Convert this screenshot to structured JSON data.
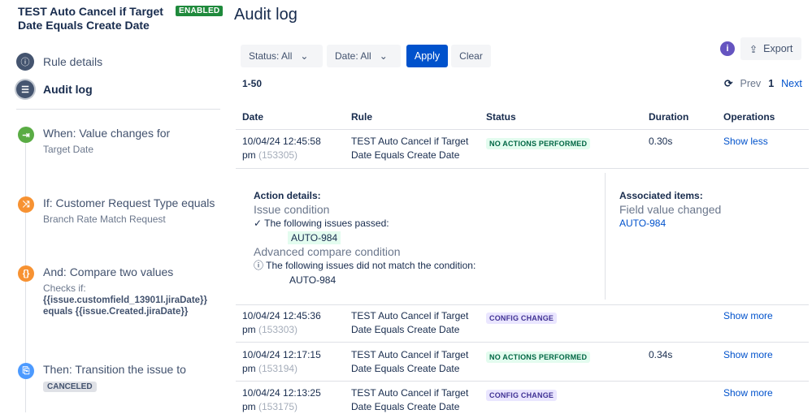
{
  "sidebar": {
    "rule_title": "TEST Auto Cancel if Target Date Equals Create Date",
    "status_badge": "ENABLED",
    "nav": [
      {
        "label": "Rule details",
        "icon": "info-icon"
      },
      {
        "label": "Audit log",
        "icon": "list-icon"
      }
    ],
    "steps": [
      {
        "title": "When: Value changes for",
        "sub": "Target Date",
        "icon": "trigger-icon",
        "color": "#5aac44"
      },
      {
        "title": "If: Customer Request Type equals",
        "sub": "Branch Rate Match Request",
        "icon": "branch-icon",
        "color": "#f79232"
      },
      {
        "title": "And: Compare two values",
        "sub": "Checks if:",
        "expr1": "{{issue.customfield_13901l.jiraDate}}",
        "expr2": "equals {{issue.Created.jiraDate}}",
        "icon": "braces-icon",
        "color": "#f79232"
      },
      {
        "title": "Then: Transition the issue to",
        "lozenge": "CANCELED",
        "icon": "action-icon",
        "color": "#4c9aff"
      }
    ]
  },
  "main": {
    "title": "Audit log",
    "filters": {
      "status": "Status: All",
      "date": "Date: All",
      "apply": "Apply",
      "clear": "Clear"
    },
    "export": "Export",
    "range": "1-50",
    "pagination": {
      "prev": "Prev",
      "page": "1",
      "next": "Next"
    },
    "columns": [
      "Date",
      "Rule",
      "Status",
      "Duration",
      "Operations"
    ],
    "rows": [
      {
        "date": "10/04/24 12:45:58",
        "ampm": "pm",
        "id": "(153305)",
        "rule1": "TEST Auto Cancel if Target",
        "rule2": "Date Equals Create Date",
        "status": "NO ACTIONS PERFORMED",
        "duration": "0.30s",
        "op": "Show less"
      },
      {
        "date": "10/04/24 12:45:36",
        "ampm": "pm",
        "id": "(153303)",
        "rule1": "TEST Auto Cancel if Target",
        "rule2": "Date Equals Create Date",
        "status": "CONFIG CHANGE",
        "duration": "",
        "op": "Show more"
      },
      {
        "date": "10/04/24 12:17:15",
        "ampm": "pm",
        "id": "(153194)",
        "rule1": "TEST Auto Cancel if Target",
        "rule2": "Date Equals Create Date",
        "status": "NO ACTIONS PERFORMED",
        "duration": "0.34s",
        "op": "Show more"
      },
      {
        "date": "10/04/24 12:13:25",
        "ampm": "pm",
        "id": "(153175)",
        "rule1": "TEST Auto Cancel if Target",
        "rule2": "Date Equals Create Date",
        "status": "CONFIG CHANGE",
        "duration": "",
        "op": "Show more"
      }
    ],
    "details": {
      "action_heading": "Action details:",
      "c1_title": "Issue condition",
      "c1_msg": "The following issues passed:",
      "c1_issue": "AUTO-984",
      "c2_title": "Advanced compare condition",
      "c2_msg": "The following issues did not match the condition:",
      "c2_issue": "AUTO-984",
      "assoc_heading": "Associated items:",
      "assoc_type": "Field value changed",
      "assoc_issue": "AUTO-984"
    }
  }
}
